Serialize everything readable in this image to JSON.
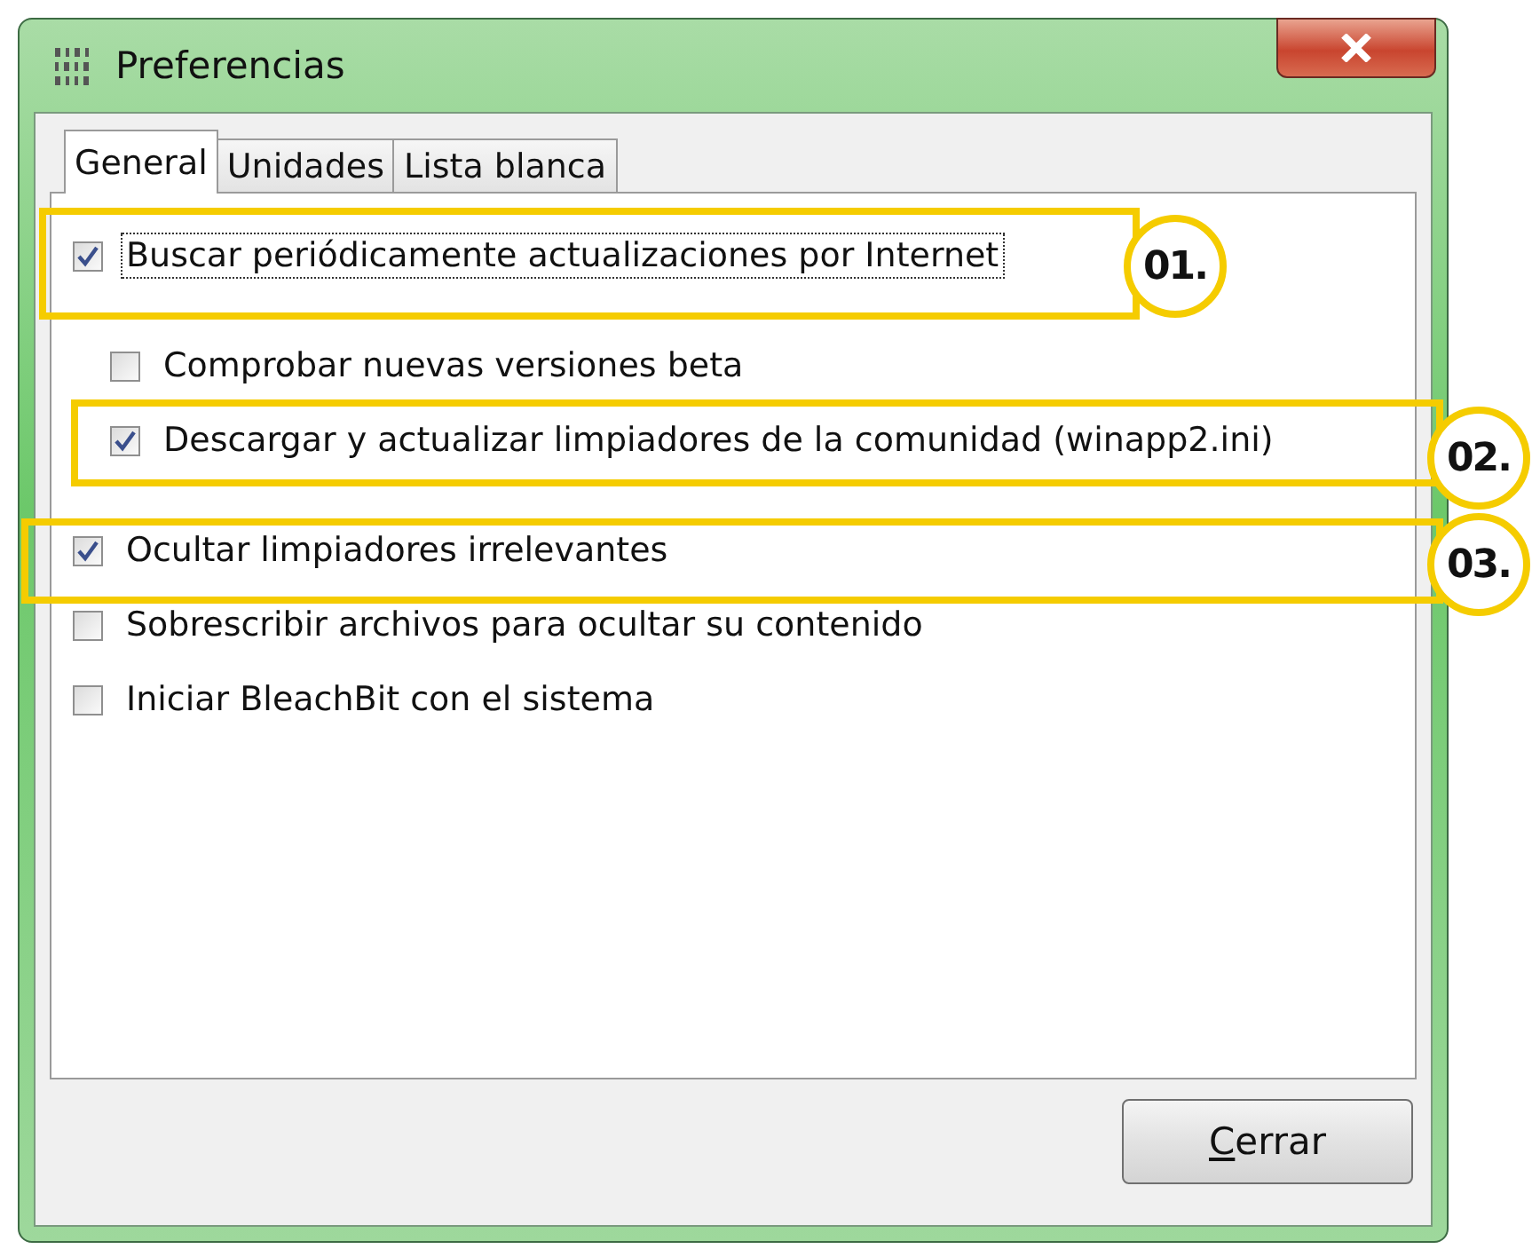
{
  "window": {
    "title": "Preferencias"
  },
  "tabs": [
    {
      "label": "General",
      "selected": true
    },
    {
      "label": "Unidades",
      "selected": false
    },
    {
      "label": "Lista blanca",
      "selected": false
    }
  ],
  "options": [
    {
      "label": "Buscar periódicamente actualizaciones por Internet",
      "checked": true,
      "focused": true,
      "children": [
        {
          "label": "Comprobar nuevas versiones beta",
          "checked": false,
          "focused": false
        },
        {
          "label": "Descargar y actualizar limpiadores de la comunidad (winapp2.ini)",
          "checked": true,
          "focused": false
        }
      ]
    },
    {
      "label": "Ocultar limpiadores irrelevantes",
      "checked": true,
      "focused": false
    },
    {
      "label": "Sobrescribir archivos para ocultar su contenido",
      "checked": false,
      "focused": false
    },
    {
      "label": "Iniciar BleachBit con el sistema",
      "checked": false,
      "focused": false
    }
  ],
  "annotations": [
    {
      "label": "01."
    },
    {
      "label": "02."
    },
    {
      "label": "03."
    }
  ],
  "close_button": {
    "label": "Cerrar",
    "first_letter_underlined": true
  }
}
